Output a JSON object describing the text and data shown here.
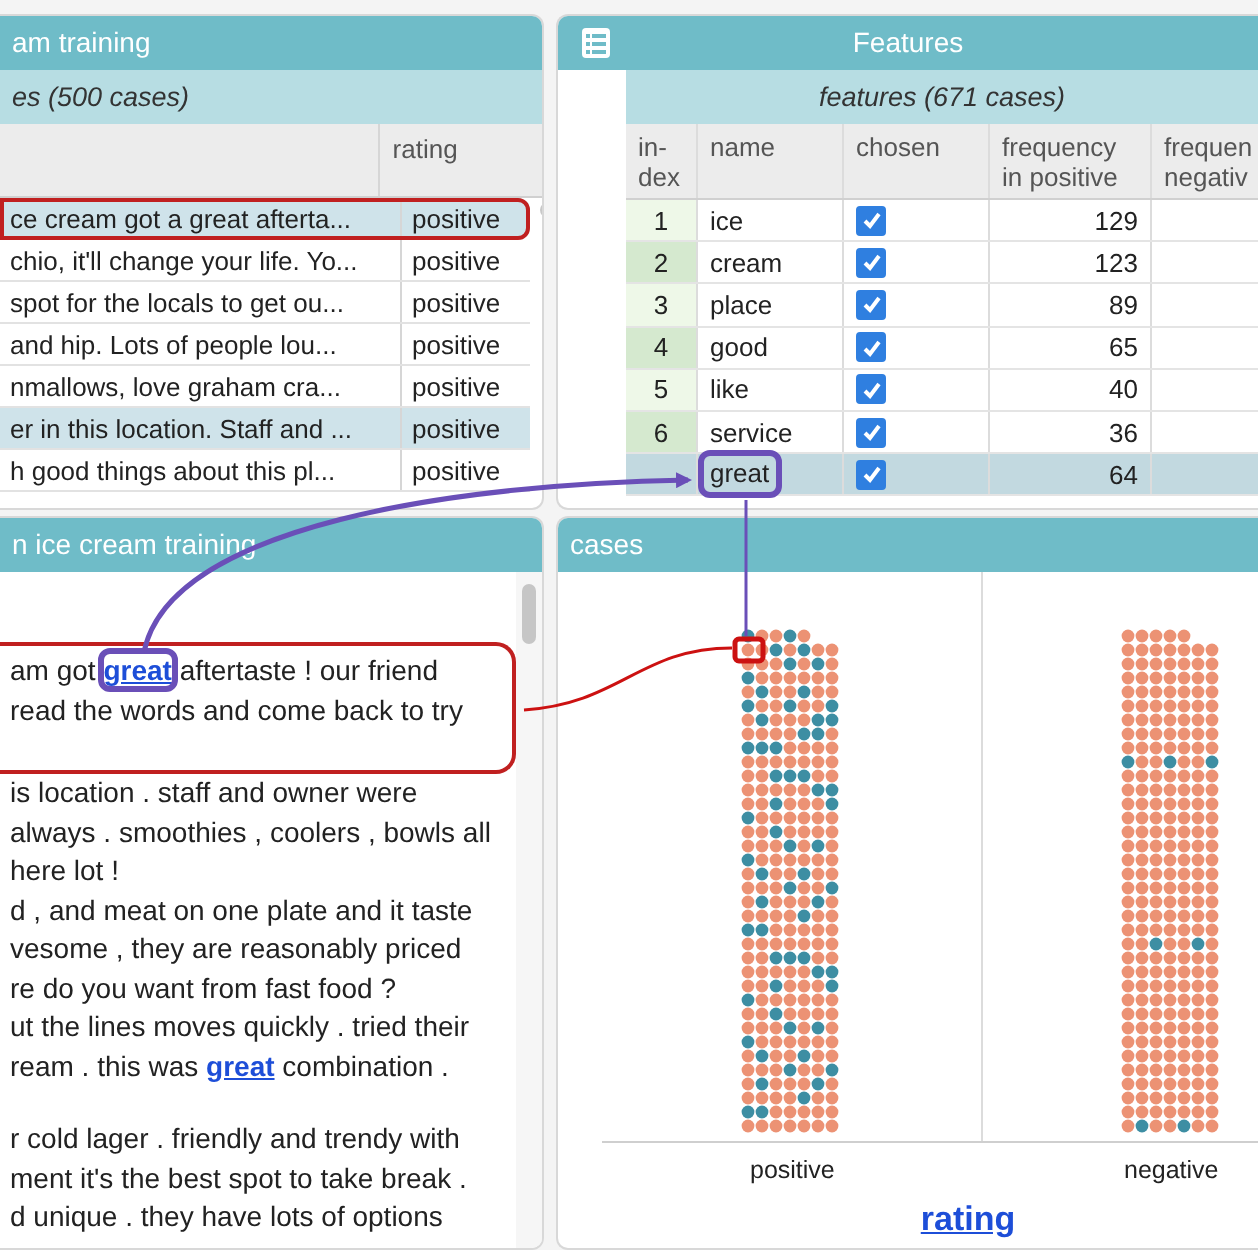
{
  "cases_table": {
    "title": "am training",
    "subtitle": "es (500 cases)",
    "columns": [
      "rating"
    ],
    "rows": [
      {
        "text": "ce cream got a great afterta...",
        "rating": "positive",
        "selected": true,
        "outlined": true
      },
      {
        "text": "chio, it'll change your life. Yo...",
        "rating": "positive",
        "selected": false,
        "outlined": false
      },
      {
        "text": "spot for the locals to get ou...",
        "rating": "positive",
        "selected": false,
        "outlined": false
      },
      {
        "text": "and hip. Lots of people lou...",
        "rating": "positive",
        "selected": false,
        "outlined": false
      },
      {
        "text": "nmallows, love graham cra...",
        "rating": "positive",
        "selected": false,
        "outlined": false
      },
      {
        "text": "er in this location. Staff and ...",
        "rating": "positive",
        "selected": true,
        "outlined": false
      },
      {
        "text": "h good things about this pl...",
        "rating": "positive",
        "selected": false,
        "outlined": false
      }
    ]
  },
  "features_table": {
    "title": "Features",
    "subtitle": "features (671 cases)",
    "columns": [
      [
        "in-",
        "dex"
      ],
      [
        "name"
      ],
      [
        "chosen"
      ],
      [
        "frequency",
        "in positive"
      ],
      [
        "frequen",
        "negativ"
      ]
    ],
    "rows": [
      {
        "index": "1",
        "name": "ice",
        "chosen": true,
        "freq_positive": "129",
        "selected": false,
        "outlined": false
      },
      {
        "index": "2",
        "name": "cream",
        "chosen": true,
        "freq_positive": "123",
        "selected": false,
        "outlined": false
      },
      {
        "index": "3",
        "name": "place",
        "chosen": true,
        "freq_positive": "89",
        "selected": false,
        "outlined": false
      },
      {
        "index": "4",
        "name": "good",
        "chosen": true,
        "freq_positive": "65",
        "selected": false,
        "outlined": false
      },
      {
        "index": "5",
        "name": "like",
        "chosen": true,
        "freq_positive": "40",
        "selected": false,
        "outlined": false
      },
      {
        "index": "6",
        "name": "service",
        "chosen": true,
        "freq_positive": "36",
        "selected": false,
        "outlined": false
      },
      {
        "name": "great",
        "chosen": true,
        "freq_positive": "64",
        "selected": true,
        "outlined": true
      }
    ]
  },
  "text_panel": {
    "title": "n ice cream training",
    "cases": [
      {
        "outlined": true,
        "lines": [
          [
            {
              "text": "am got "
            },
            {
              "link": "great",
              "outlined": true
            },
            {
              "text": " aftertaste ! our friend"
            }
          ],
          [
            {
              "text": "read the words and come back to try"
            }
          ]
        ]
      },
      {
        "outlined": false,
        "lines": [
          [
            {
              "text": "is location . staff and owner were"
            }
          ],
          [
            {
              "text": "always . smoothies , coolers , bowls all"
            }
          ],
          [
            {
              "text": "here lot !"
            }
          ],
          [
            {
              "text": "d , and meat on one plate and it taste"
            }
          ],
          [
            {
              "text": "vesome , they are reasonably priced"
            }
          ],
          [
            {
              "text": "re do you want from fast food ?"
            }
          ],
          [
            {
              "text": "ut the lines moves quickly . tried their"
            }
          ],
          [
            {
              "text": "ream . this was "
            },
            {
              "link": "great",
              "outlined": false
            },
            {
              "text": " combination ."
            }
          ]
        ]
      },
      {
        "outlined": false,
        "lines": [
          [
            {
              "text": "r cold lager . friendly and trendy with"
            }
          ],
          [
            {
              "text": "ment it's the best spot to take break ."
            }
          ],
          [
            {
              "text": "d unique . they have lots of options"
            }
          ]
        ]
      }
    ]
  },
  "cases_plot": {
    "title": "cases",
    "categories": [
      "positive",
      "negative"
    ],
    "axis_label": "rating"
  }
}
